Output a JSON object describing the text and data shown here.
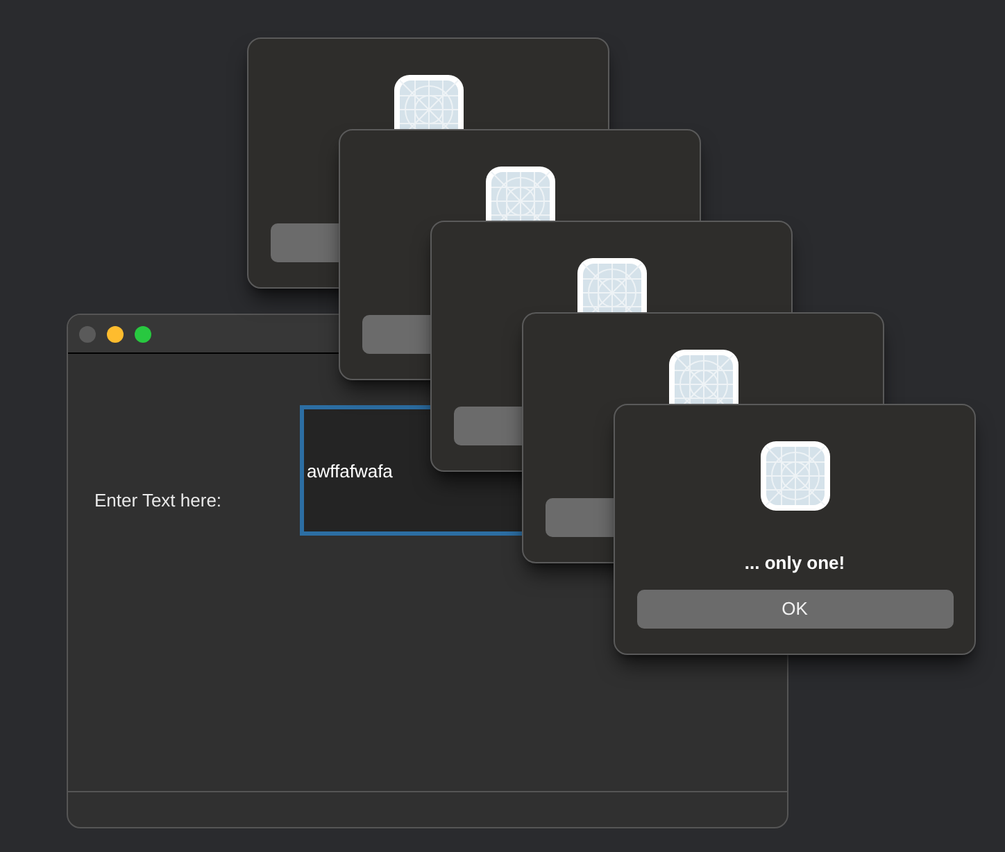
{
  "main_window": {
    "traffic_lights": [
      {
        "kind": "close",
        "disabled": true
      },
      {
        "kind": "minimize",
        "disabled": false
      },
      {
        "kind": "zoom",
        "disabled": false
      }
    ],
    "label": "Enter Text here:",
    "text_field": {
      "value": "awffafwafa",
      "focused": true
    }
  },
  "dialogs": [
    {
      "kind": "alert"
    },
    {
      "kind": "alert"
    },
    {
      "kind": "alert"
    },
    {
      "kind": "alert"
    },
    {
      "kind": "alert",
      "message": "... only one!",
      "button": "OK"
    }
  ]
}
